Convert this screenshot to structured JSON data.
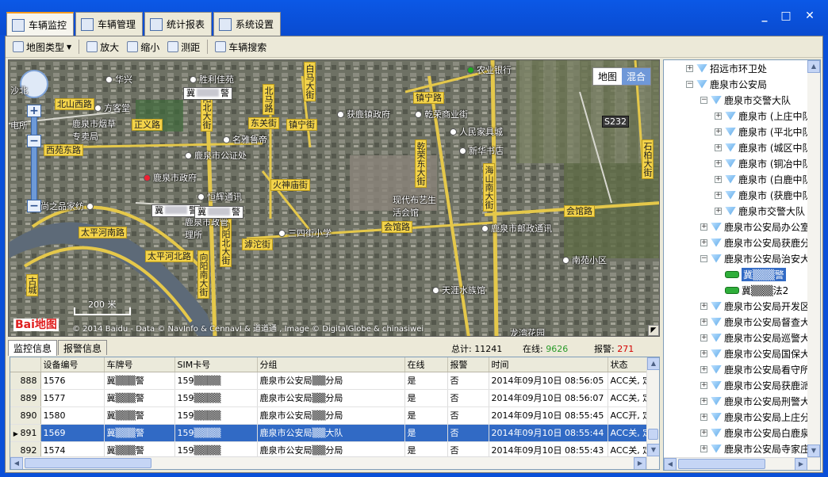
{
  "window": {
    "minimize": "_",
    "maximize": "□",
    "close": "✕"
  },
  "tabs": [
    {
      "label": "车辆监控",
      "active": true
    },
    {
      "label": "车辆管理",
      "active": false
    },
    {
      "label": "统计报表",
      "active": false
    },
    {
      "label": "系统设置",
      "active": false
    }
  ],
  "toolbar": {
    "map_type": "地图类型",
    "zoom_in": "放大",
    "zoom_out": "缩小",
    "measure": "测距",
    "vehicle_search": "车辆搜索"
  },
  "map": {
    "type_map": "地图",
    "type_hybrid": "混合",
    "scale": "200 米",
    "copyright": "© 2014 Baidu - Data © NavInfo & CennavI & 道道通 , Image © DigitalGlobe & chinasiwei",
    "logo": "Bai地图",
    "road_labels": [
      "北山西路",
      "西苑东路",
      "正义路",
      "向阳北大街",
      "阳北大街",
      "北马路",
      "东关街",
      "镇宁街",
      "火神庙街",
      "太平河南路",
      "太平河北路",
      "向阳南大街",
      "滹沱街",
      "会馆路",
      "会馆路",
      "镇宁路",
      "海山南大街",
      "石柏大街",
      "乾荣东大街",
      "古城",
      "S232",
      "白马大街"
    ],
    "places": [
      "华兴",
      "方客堂",
      "胜利佳苑",
      "鹿泉市烟草专卖局",
      "鹿泉市公证处",
      "名雅鲁帝",
      "鹿泉市政府",
      "恒辉通讯",
      "尚之品家纺",
      "鹿泉市政管理所",
      "三四街小学",
      "获鹿镇政府",
      "乾荣商业街",
      "人民家具城",
      "新华书店",
      "现代布艺生活会馆",
      "鹿泉市邮政通讯",
      "南苑小区",
      "天涯水族馆",
      "农业银行",
      "龙湾花园",
      "电所",
      "沙北"
    ],
    "vehicles": [
      {
        "prefix": "冀",
        "suffix": "警"
      },
      {
        "prefix": "冀",
        "suffix": "警"
      },
      {
        "prefix": "冀",
        "suffix": "警"
      }
    ]
  },
  "bottom_tabs": [
    "监控信息",
    "报警信息"
  ],
  "stats": {
    "total_label": "总计:",
    "total": "11241",
    "online_label": "在线:",
    "online": "9626",
    "alarm_label": "报警:",
    "alarm": "271",
    "online_color": "#2a9b2a",
    "alarm_color": "#d40000"
  },
  "grid": {
    "columns": [
      "设备编号",
      "车牌号",
      "SIM卡号",
      "分组",
      "在线",
      "报警",
      "时间",
      "状态"
    ],
    "rows": [
      {
        "idx": "888",
        "device": "1576",
        "plate": "冀▒▒▒警",
        "sim": "159▒▒▒▒",
        "group": "鹿泉市公安局▒▒分局",
        "online": "是",
        "alarm": "否",
        "time": "2014年09月10日  08:56:05",
        "status": "ACC关, 定",
        "selected": false
      },
      {
        "idx": "889",
        "device": "1577",
        "plate": "冀▒▒▒警",
        "sim": "159▒▒▒▒",
        "group": "鹿泉市公安局▒▒分局",
        "online": "是",
        "alarm": "否",
        "time": "2014年09月10日  08:56:07",
        "status": "ACC关, 定",
        "selected": false
      },
      {
        "idx": "890",
        "device": "1580",
        "plate": "冀▒▒▒警",
        "sim": "159▒▒▒▒",
        "group": "鹿泉市公安局▒▒分局",
        "online": "是",
        "alarm": "否",
        "time": "2014年09月10日  08:55:45",
        "status": "ACC开, 定",
        "selected": false
      },
      {
        "idx": "891",
        "device": "1569",
        "plate": "冀▒▒▒警",
        "sim": "159▒▒▒▒",
        "group": "鹿泉市公安局▒▒大队",
        "online": "是",
        "alarm": "否",
        "time": "2014年09月10日  08:55:44",
        "status": "ACC关, 定",
        "selected": true
      },
      {
        "idx": "892",
        "device": "1574",
        "plate": "冀▒▒▒警",
        "sim": "159▒▒▒▒",
        "group": "鹿泉市公安局▒▒分局",
        "online": "是",
        "alarm": "否",
        "time": "2014年09月10日  08:55:43",
        "status": "ACC关, 定",
        "selected": false
      }
    ]
  },
  "tree": [
    {
      "label": "招远市环卫处",
      "level": 0,
      "expander": "+",
      "kind": "group"
    },
    {
      "label": "鹿泉市公安局",
      "level": 0,
      "expander": "−",
      "kind": "group"
    },
    {
      "label": "鹿泉市交警大队",
      "level": 1,
      "expander": "−",
      "kind": "group"
    },
    {
      "label": "鹿泉市 (上庄中队",
      "level": 2,
      "expander": "+",
      "kind": "group"
    },
    {
      "label": "鹿泉市 (平北中队",
      "level": 2,
      "expander": "+",
      "kind": "group"
    },
    {
      "label": "鹿泉市 (城区中队",
      "level": 2,
      "expander": "+",
      "kind": "group"
    },
    {
      "label": "鹿泉市 (铜冶中队",
      "level": 2,
      "expander": "+",
      "kind": "group"
    },
    {
      "label": "鹿泉市 (白鹿中队",
      "level": 2,
      "expander": "+",
      "kind": "group"
    },
    {
      "label": "鹿泉市 (获鹿中队",
      "level": 2,
      "expander": "+",
      "kind": "group"
    },
    {
      "label": "鹿泉市交警大队",
      "level": 2,
      "expander": "+",
      "kind": "group"
    },
    {
      "label": "鹿泉市公安局办公室",
      "level": 1,
      "expander": "+",
      "kind": "group"
    },
    {
      "label": "鹿泉市公安局获鹿分局",
      "level": 1,
      "expander": "+",
      "kind": "group"
    },
    {
      "label": "鹿泉市公安局治安大队",
      "level": 1,
      "expander": "−",
      "kind": "group"
    },
    {
      "label": "冀▒▒▒警",
      "level": 2,
      "expander": "",
      "kind": "vehicle",
      "selected": true
    },
    {
      "label": "冀▒▒▒法2",
      "level": 2,
      "expander": "",
      "kind": "vehicle",
      "selected": false
    },
    {
      "label": "鹿泉市公安局开发区分局",
      "level": 1,
      "expander": "+",
      "kind": "group"
    },
    {
      "label": "鹿泉市公安局督查大队",
      "level": 1,
      "expander": "+",
      "kind": "group"
    },
    {
      "label": "鹿泉市公安局巡警大队",
      "level": 1,
      "expander": "+",
      "kind": "group"
    },
    {
      "label": "鹿泉市公安局国保大队",
      "level": 1,
      "expander": "+",
      "kind": "group"
    },
    {
      "label": "鹿泉市公安局看守所",
      "level": 1,
      "expander": "+",
      "kind": "group"
    },
    {
      "label": "鹿泉市公安局获鹿派出所",
      "level": 1,
      "expander": "+",
      "kind": "group"
    },
    {
      "label": "鹿泉市公安局刑警大队",
      "level": 1,
      "expander": "+",
      "kind": "group"
    },
    {
      "label": "鹿泉市公安局上庄分局",
      "level": 1,
      "expander": "+",
      "kind": "group"
    },
    {
      "label": "鹿泉市公安局白鹿泉派出所",
      "level": 1,
      "expander": "+",
      "kind": "group"
    },
    {
      "label": "鹿泉市公安局寺家庄派出所",
      "level": 1,
      "expander": "+",
      "kind": "group"
    }
  ]
}
